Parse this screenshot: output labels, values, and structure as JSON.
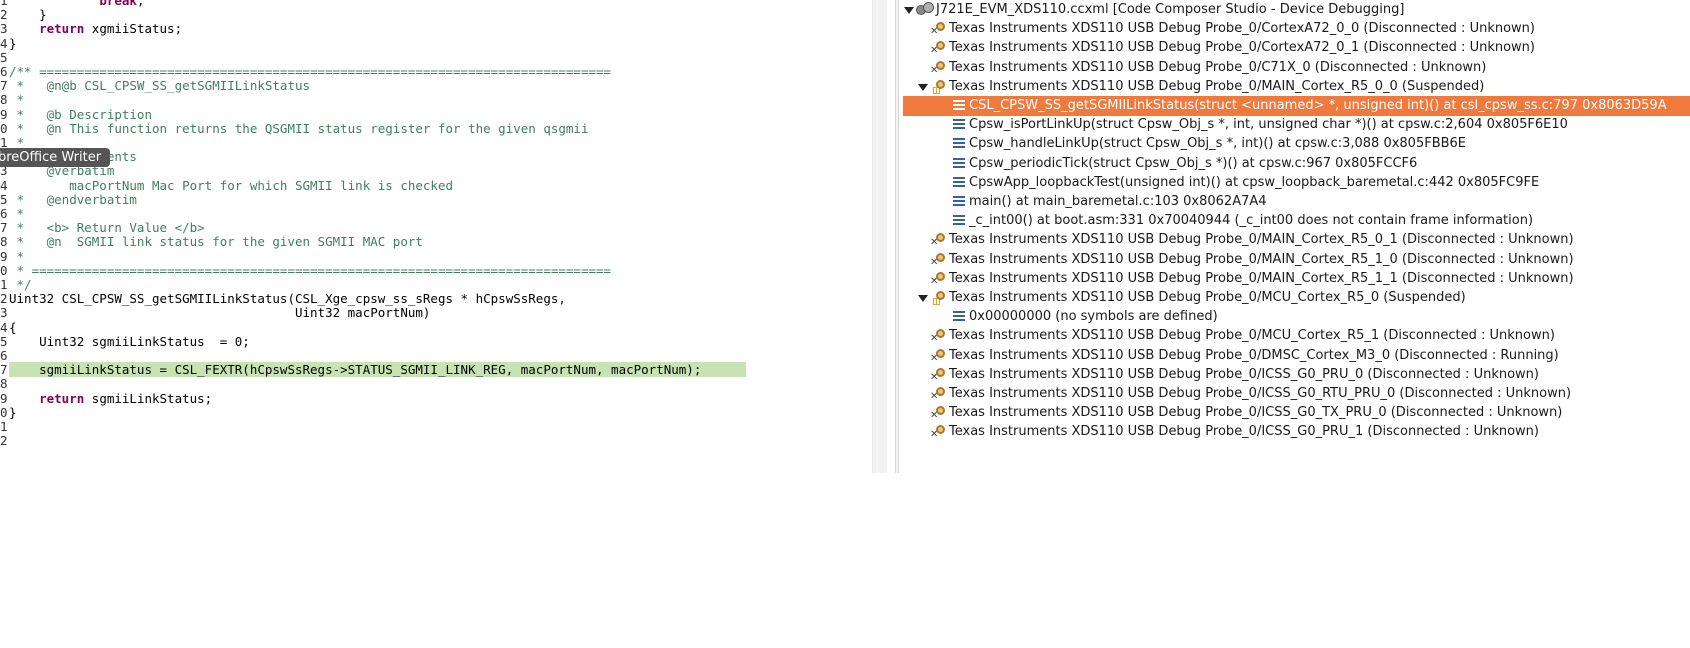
{
  "editor": {
    "tooltip": "breOffice Writer",
    "lines": [
      {
        "ln": "1",
        "text": "            break;",
        "cls": "kw-partial"
      },
      {
        "ln": "2",
        "text": "    }",
        "cls": ""
      },
      {
        "ln": "3",
        "text": "    return xgmiiStatus;",
        "cls": "ret"
      },
      {
        "ln": "4",
        "text": "}",
        "cls": ""
      },
      {
        "ln": "5",
        "text": "",
        "cls": ""
      },
      {
        "ln": "6",
        "text": "/** ============================================================================",
        "cls": "comment"
      },
      {
        "ln": "7",
        "text": " *   @n@b CSL_CPSW_SS_getSGMIILinkStatus",
        "cls": "comment"
      },
      {
        "ln": "8",
        "text": " *",
        "cls": "comment"
      },
      {
        "ln": "9",
        "text": " *   @b Description",
        "cls": "comment"
      },
      {
        "ln": "0",
        "text": " *   @n This function returns the QSGMII status register for the given qsgmii",
        "cls": "comment"
      },
      {
        "ln": "1",
        "text": " *",
        "cls": "comment"
      },
      {
        "ln": "2",
        "text": " *   @b Arguments",
        "cls": "comment"
      },
      {
        "ln": "3",
        "text": "     @verbatim",
        "cls": "comment"
      },
      {
        "ln": "4",
        "text": "        macPortNum Mac Port for which SGMII link is checked",
        "cls": "comment"
      },
      {
        "ln": "5",
        "text": " *   @endverbatim",
        "cls": "comment"
      },
      {
        "ln": "6",
        "text": " *",
        "cls": "comment"
      },
      {
        "ln": "7",
        "text": " *   <b> Return Value </b>",
        "cls": "comment"
      },
      {
        "ln": "8",
        "text": " *   @n  SGMII link status for the given SGMII MAC port",
        "cls": "comment"
      },
      {
        "ln": "9",
        "text": " *",
        "cls": "comment"
      },
      {
        "ln": "0",
        "text": " * =============================================================================",
        "cls": "comment"
      },
      {
        "ln": "1",
        "text": " */",
        "cls": "comment"
      },
      {
        "ln": "2",
        "text": "Uint32 CSL_CPSW_SS_getSGMIILinkStatus(CSL_Xge_cpsw_ss_sRegs * hCpswSsRegs,",
        "cls": ""
      },
      {
        "ln": "3",
        "text": "                                      Uint32 macPortNum)",
        "cls": ""
      },
      {
        "ln": "4",
        "text": "{",
        "cls": ""
      },
      {
        "ln": "5",
        "text": "    Uint32 sgmiiLinkStatus  = 0;",
        "cls": ""
      },
      {
        "ln": "6",
        "text": "",
        "cls": ""
      },
      {
        "ln": "7",
        "text": "    sgmiiLinkStatus = CSL_FEXTR(hCpswSsRegs->STATUS_SGMII_LINK_REG, macPortNum, macPortNum);",
        "cls": "hl"
      },
      {
        "ln": "8",
        "text": "",
        "cls": ""
      },
      {
        "ln": "9",
        "text": "    return sgmiiLinkStatus;",
        "cls": "ret"
      },
      {
        "ln": "0",
        "text": "}",
        "cls": ""
      },
      {
        "ln": "1",
        "text": "",
        "cls": ""
      },
      {
        "ln": "2",
        "text": "",
        "cls": ""
      }
    ]
  },
  "debug": {
    "items": [
      {
        "indent": 0,
        "type": "root",
        "expanded": true,
        "label": "J721E_EVM_XDS110.ccxml [Code Composer Studio - Device Debugging]"
      },
      {
        "indent": 1,
        "type": "target",
        "expanded": false,
        "label": "Texas Instruments XDS110 USB Debug Probe_0/CortexA72_0_0 (Disconnected : Unknown)"
      },
      {
        "indent": 1,
        "type": "target",
        "expanded": false,
        "label": "Texas Instruments XDS110 USB Debug Probe_0/CortexA72_0_1 (Disconnected : Unknown)"
      },
      {
        "indent": 1,
        "type": "target",
        "expanded": false,
        "label": "Texas Instruments XDS110 USB Debug Probe_0/C71X_0 (Disconnected : Unknown)"
      },
      {
        "indent": 1,
        "type": "suspended",
        "expanded": true,
        "label": "Texas Instruments XDS110 USB Debug Probe_0/MAIN_Cortex_R5_0_0 (Suspended)"
      },
      {
        "indent": 2,
        "type": "frame",
        "selected": true,
        "label": "CSL_CPSW_SS_getSGMIILinkStatus(struct <unnamed> *, unsigned int)() at csl_cpsw_ss.c:797 0x8063D59A"
      },
      {
        "indent": 2,
        "type": "frame",
        "label": "Cpsw_isPortLinkUp(struct Cpsw_Obj_s *, int, unsigned char *)() at cpsw.c:2,604 0x805F6E10"
      },
      {
        "indent": 2,
        "type": "frame",
        "label": "Cpsw_handleLinkUp(struct Cpsw_Obj_s *, int)() at cpsw.c:3,088 0x805FBB6E"
      },
      {
        "indent": 2,
        "type": "frame",
        "label": "Cpsw_periodicTick(struct Cpsw_Obj_s *)() at cpsw.c:967 0x805FCCF6"
      },
      {
        "indent": 2,
        "type": "frame",
        "label": "CpswApp_loopbackTest(unsigned int)() at cpsw_loopback_baremetal.c:442 0x805FC9FE"
      },
      {
        "indent": 2,
        "type": "frame",
        "label": "main() at main_baremetal.c:103 0x8062A7A4"
      },
      {
        "indent": 2,
        "type": "frame",
        "label": "_c_int00() at boot.asm:331 0x70040944  (_c_int00 does not contain frame information)"
      },
      {
        "indent": 1,
        "type": "target",
        "expanded": false,
        "label": "Texas Instruments XDS110 USB Debug Probe_0/MAIN_Cortex_R5_0_1 (Disconnected : Unknown)"
      },
      {
        "indent": 1,
        "type": "target",
        "expanded": false,
        "label": "Texas Instruments XDS110 USB Debug Probe_0/MAIN_Cortex_R5_1_0 (Disconnected : Unknown)"
      },
      {
        "indent": 1,
        "type": "target",
        "expanded": false,
        "label": "Texas Instruments XDS110 USB Debug Probe_0/MAIN_Cortex_R5_1_1 (Disconnected : Unknown)"
      },
      {
        "indent": 1,
        "type": "suspended",
        "expanded": true,
        "label": "Texas Instruments XDS110 USB Debug Probe_0/MCU_Cortex_R5_0 (Suspended)"
      },
      {
        "indent": 2,
        "type": "frame",
        "label": "0x00000000  (no symbols are defined)"
      },
      {
        "indent": 1,
        "type": "target",
        "expanded": false,
        "label": "Texas Instruments XDS110 USB Debug Probe_0/MCU_Cortex_R5_1 (Disconnected : Unknown)"
      },
      {
        "indent": 1,
        "type": "target",
        "expanded": false,
        "label": "Texas Instruments XDS110 USB Debug Probe_0/DMSC_Cortex_M3_0 (Disconnected : Running)"
      },
      {
        "indent": 1,
        "type": "target",
        "expanded": false,
        "label": "Texas Instruments XDS110 USB Debug Probe_0/ICSS_G0_PRU_0 (Disconnected : Unknown)"
      },
      {
        "indent": 1,
        "type": "target",
        "expanded": false,
        "label": "Texas Instruments XDS110 USB Debug Probe_0/ICSS_G0_RTU_PRU_0 (Disconnected : Unknown)"
      },
      {
        "indent": 1,
        "type": "target",
        "expanded": false,
        "label": "Texas Instruments XDS110 USB Debug Probe_0/ICSS_G0_TX_PRU_0 (Disconnected : Unknown)"
      },
      {
        "indent": 1,
        "type": "target",
        "expanded": false,
        "label": "Texas Instruments XDS110 USB Debug Probe_0/ICSS_G0_PRU_1 (Disconnected : Unknown)"
      }
    ]
  }
}
